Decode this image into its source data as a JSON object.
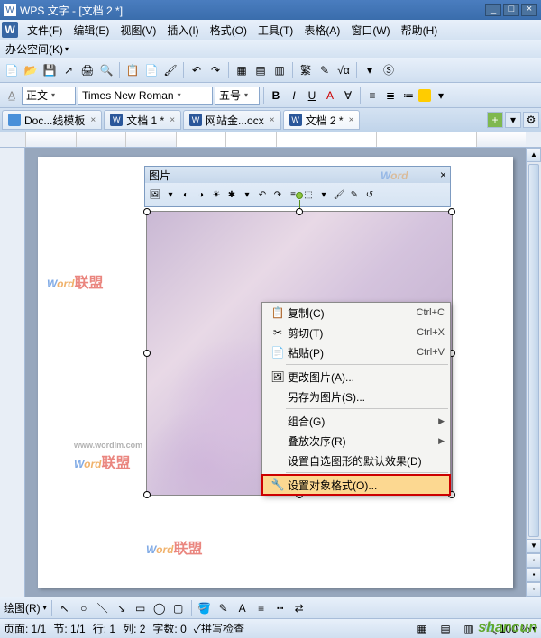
{
  "titlebar": {
    "app": "WPS 文字",
    "doc": "[文档 2 *]"
  },
  "menu": [
    "文件(F)",
    "编辑(E)",
    "视图(V)",
    "插入(I)",
    "格式(O)",
    "工具(T)",
    "表格(A)",
    "窗口(W)",
    "帮助(H)"
  ],
  "secondbar": {
    "office": "办公空间(K)"
  },
  "format": {
    "style": "正文",
    "font": "Times New Roman",
    "size": "五号",
    "B": "B",
    "I": "I",
    "U": "U",
    "A": "A"
  },
  "tabs": [
    {
      "label": "Doc...线模板"
    },
    {
      "label": "文档 1 *"
    },
    {
      "label": "网站金...ocx"
    },
    {
      "label": "文档 2 *"
    }
  ],
  "imgpanel": {
    "title": "图片"
  },
  "context": [
    {
      "icon": "📋",
      "label": "复制(C)",
      "short": "Ctrl+C"
    },
    {
      "icon": "✂",
      "label": "剪切(T)",
      "short": "Ctrl+X"
    },
    {
      "icon": "📄",
      "label": "粘贴(P)",
      "short": "Ctrl+V"
    },
    {
      "sep": true
    },
    {
      "icon": "🖼",
      "label": "更改图片(A)...",
      "short": ""
    },
    {
      "icon": "",
      "label": "另存为图片(S)...",
      "short": ""
    },
    {
      "sep": true
    },
    {
      "icon": "",
      "label": "组合(G)",
      "sub": "▶"
    },
    {
      "icon": "",
      "label": "叠放次序(R)",
      "sub": "▶"
    },
    {
      "icon": "",
      "label": "设置自选图形的默认效果(D)",
      "short": ""
    },
    {
      "sep": true
    },
    {
      "icon": "🔧",
      "label": "设置对象格式(O)...",
      "short": "",
      "hl": true
    }
  ],
  "drawbar": {
    "label": "绘图(R)"
  },
  "status": {
    "page": "页面: 1/1",
    "sec": "节: 1/1",
    "line": "行: 1",
    "col": "列: 2",
    "chars": "字数: 0",
    "spell": "拼写检查",
    "zoom": "100 %"
  },
  "watermark": {
    "w": "W",
    "ord": "ord",
    "lian": "联盟",
    "url": "www.wordlm.com"
  }
}
